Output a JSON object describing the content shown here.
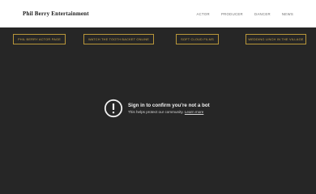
{
  "header": {
    "site_title": "Phil Berry Entertainment",
    "nav": [
      "ACTOR",
      "PRODUCER",
      "DANCER",
      "NEWS"
    ]
  },
  "links": [
    "PHIL BERRY ACTOR PAGE",
    "WATCH THE TOOTH BACKET ONLINE",
    "SOFT CLOUD FILMS",
    "WEDDING LINCH IN THE VILLAGE"
  ],
  "embed": {
    "icon": "alert-circle-icon",
    "title": "Sign in to confirm you’re not a bot",
    "subtitle": "This helps protect our community.",
    "learn_more": "Learn more"
  },
  "colors": {
    "background": "#262626",
    "header": "#ffffff",
    "gold": "#b8963a"
  }
}
